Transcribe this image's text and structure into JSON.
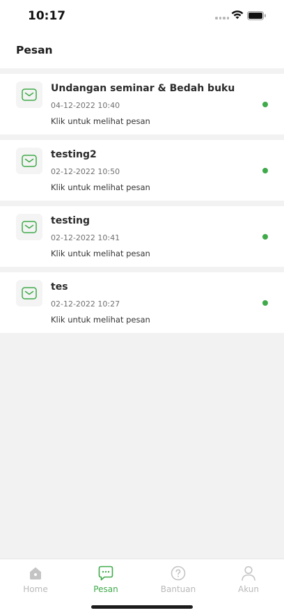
{
  "status_bar": {
    "time": "10:17"
  },
  "header": {
    "title": "Pesan"
  },
  "messages": [
    {
      "title": "Undangan seminar & Bedah buku",
      "date": "04-12-2022 10:40",
      "hint": "Klik untuk melihat pesan",
      "unread": true
    },
    {
      "title": "testing2",
      "date": "02-12-2022 10:50",
      "hint": "Klik untuk melihat pesan",
      "unread": true
    },
    {
      "title": "testing",
      "date": "02-12-2022 10:41",
      "hint": "Klik untuk melihat pesan",
      "unread": true
    },
    {
      "title": "tes",
      "date": "02-12-2022 10:27",
      "hint": "Klik untuk melihat pesan",
      "unread": true
    }
  ],
  "tab_bar": {
    "tabs": [
      {
        "label": "Home",
        "icon": "home-icon",
        "active": false
      },
      {
        "label": "Pesan",
        "icon": "chat-icon",
        "active": true
      },
      {
        "label": "Bantuan",
        "icon": "help-icon",
        "active": false
      },
      {
        "label": "Akun",
        "icon": "user-icon",
        "active": false
      }
    ]
  },
  "colors": {
    "accent": "#3faa4a",
    "inactive": "#b9b9b9",
    "background": "#f2f2f2"
  }
}
